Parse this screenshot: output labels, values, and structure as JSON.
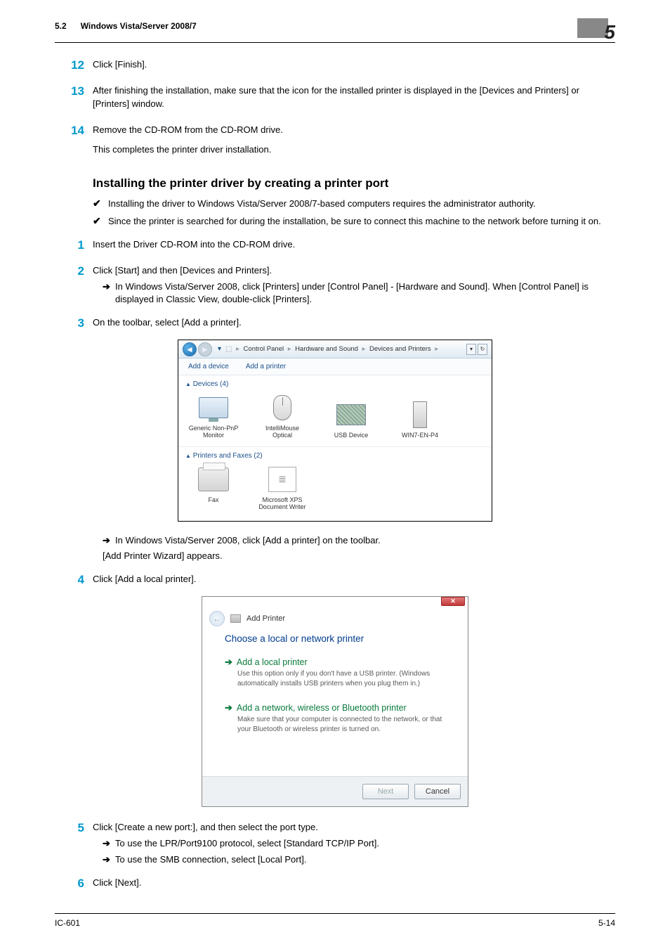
{
  "header": {
    "section_number": "5.2",
    "section_title": "Windows Vista/Server 2008/7",
    "chapter_number": "5"
  },
  "steps_top": [
    {
      "num": "12",
      "text": "Click [Finish]."
    },
    {
      "num": "13",
      "text": "After finishing the installation, make sure that the icon for the installed printer is displayed in the [Devices and Printers] or [Printers]  window."
    },
    {
      "num": "14",
      "text": "Remove the CD-ROM from the CD-ROM drive.",
      "tail": "This completes the printer driver installation."
    }
  ],
  "h2": "Installing the printer driver by creating a printer port",
  "checks": [
    "Installing the driver to Windows Vista/Server 2008/7-based computers requires the administrator authority.",
    "Since the printer is searched for during the installation, be sure to connect this machine to the network before turning it on."
  ],
  "step1": {
    "num": "1",
    "text": "Insert  the Driver CD-ROM into the CD-ROM drive."
  },
  "step2": {
    "num": "2",
    "text": "Click [Start] and then [Devices and Printers].",
    "sub": "In Windows Vista/Server 2008, click [Printers] under [Control Panel] - [Hardware and Sound]. When [Control Panel] is displayed in Classic View, double-click [Printers]."
  },
  "step3": {
    "num": "3",
    "text": "On the toolbar, select [Add a printer].",
    "sub": "In Windows Vista/Server 2008, click [Add a printer] on the toolbar.",
    "note": "[Add Printer Wizard] appears."
  },
  "step4": {
    "num": "4",
    "text": "Click [Add a local printer]."
  },
  "step5": {
    "num": "5",
    "text": "Click [Create a new port:], and then select the port type.",
    "sub1": "To use the LPR/Port9100 protocol, select [Standard TCP/IP Port].",
    "sub2": "To use the SMB connection, select [Local Port]."
  },
  "step6": {
    "num": "6",
    "text": "Click [Next]."
  },
  "screenshot1": {
    "path_segments": [
      "Control Panel",
      "Hardware and Sound",
      "Devices and Printers"
    ],
    "toolbar": {
      "add_device": "Add a device",
      "add_printer": "Add a printer"
    },
    "section_devices": "Devices (4)",
    "devices": [
      {
        "label": "Generic Non-PnP Monitor"
      },
      {
        "label": "IntelliMouse Optical"
      },
      {
        "label": "USB Device"
      },
      {
        "label": "WIN7-EN-P4"
      }
    ],
    "section_faxes": "Printers and Faxes (2)",
    "faxes": [
      {
        "label": "Fax"
      },
      {
        "label": "Microsoft XPS Document Writer"
      }
    ]
  },
  "screenshot2": {
    "title": "Add Printer",
    "heading": "Choose a local or network printer",
    "opt1_title": "Add a local printer",
    "opt1_desc": "Use this option only if you don't have a USB printer. (Windows automatically installs USB printers when you plug them in.)",
    "opt2_title": "Add a network, wireless or Bluetooth printer",
    "opt2_desc": "Make sure that your computer is connected to the network, or that your Bluetooth or wireless printer is turned on.",
    "btn_next": "Next",
    "btn_cancel": "Cancel"
  },
  "footer": {
    "left": "IC-601",
    "right": "5-14"
  }
}
